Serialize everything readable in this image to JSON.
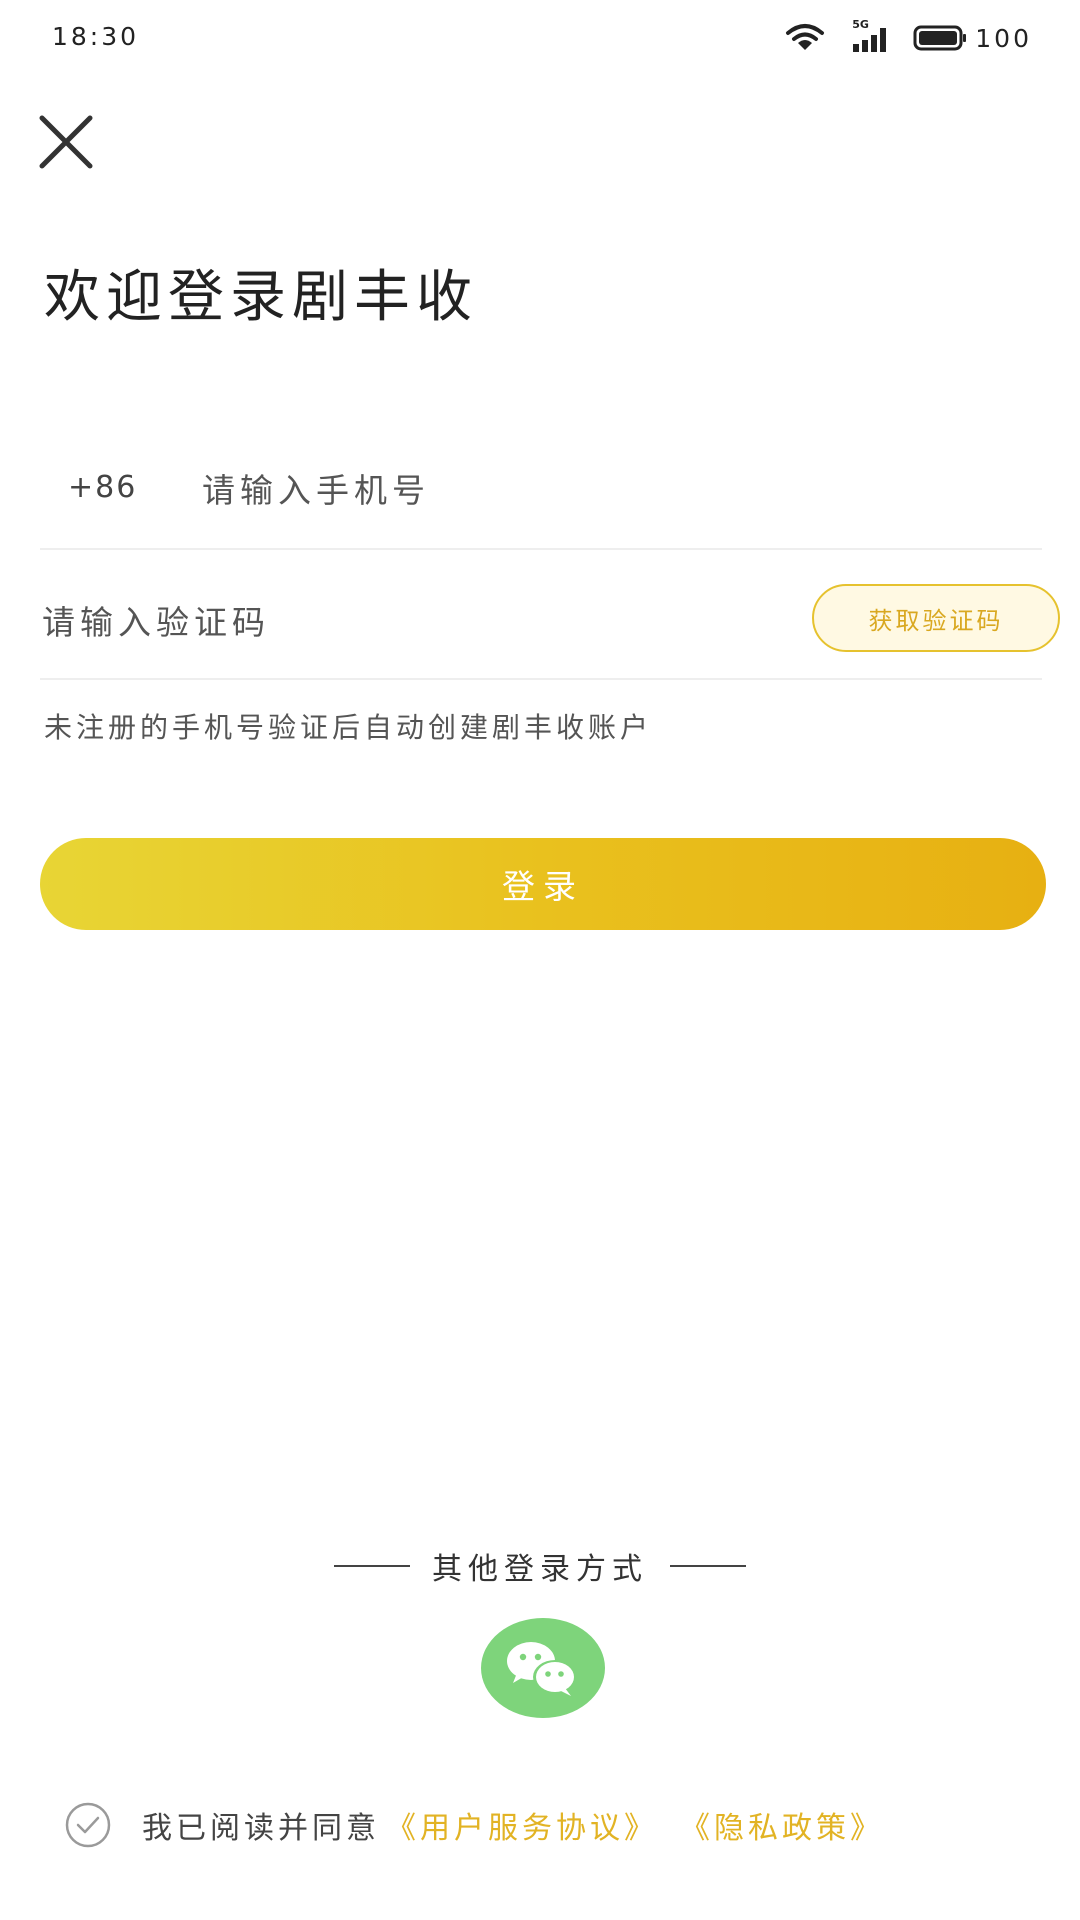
{
  "status_bar": {
    "time": "18:30",
    "battery": "100",
    "signal_label": "5G",
    "icons": [
      "wifi-icon",
      "cellular-5g-icon",
      "battery-icon"
    ]
  },
  "header": {
    "close_icon": "close-icon",
    "title": "欢迎登录剧丰收"
  },
  "form": {
    "country_code": "+86",
    "phone_placeholder": "请输入手机号",
    "phone_value": "",
    "code_placeholder": "请输入验证码",
    "code_value": "",
    "get_code_label": "获取验证码",
    "hint": "未注册的手机号验证后自动创建剧丰收账户",
    "login_label": "登录"
  },
  "other_login": {
    "title": "其他登录方式",
    "wechat_icon": "wechat-icon"
  },
  "agreement": {
    "prefix": "我已阅读并同意",
    "terms_link": "《用户服务协议》",
    "privacy_link": "《隐私政策》",
    "checked": false
  },
  "colors": {
    "accent": "#e6b616",
    "accent_light": "#e8d535",
    "link": "#e2b324",
    "wechat_green": "#7ed47b"
  }
}
